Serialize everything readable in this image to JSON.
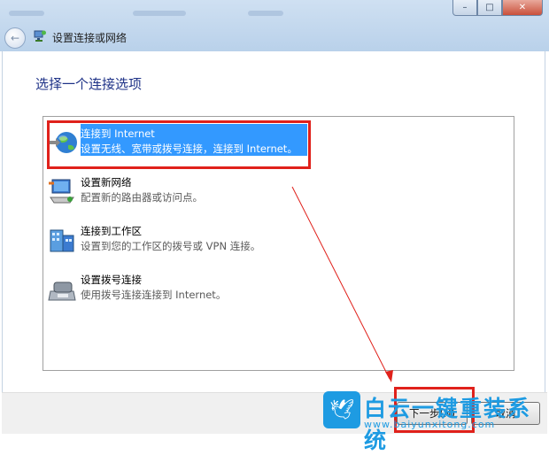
{
  "window": {
    "nav_title": "设置连接或网络",
    "min_label": "–",
    "max_label": "□",
    "close_label": "✕",
    "back_label": "←"
  },
  "main": {
    "heading": "选择一个连接选项",
    "options": [
      {
        "title": "连接到 Internet",
        "desc": "设置无线、宽带或拨号连接，连接到 Internet。",
        "icon": "globe-icon",
        "selected": true
      },
      {
        "title": "设置新网络",
        "desc": "配置新的路由器或访问点。",
        "icon": "network-icon",
        "selected": false
      },
      {
        "title": "连接到工作区",
        "desc": "设置到您的工作区的拨号或 VPN 连接。",
        "icon": "workplace-icon",
        "selected": false
      },
      {
        "title": "设置拨号连接",
        "desc": "使用拨号连接连接到 Internet。",
        "icon": "phone-icon",
        "selected": false
      }
    ]
  },
  "footer": {
    "next_label": "下一步(N)",
    "cancel_label": "取消"
  },
  "watermark": {
    "title": "白云一键重装系统",
    "url": "www.baiyunxitong.com"
  },
  "colors": {
    "selection": "#3399ff",
    "annotation": "#e0211b",
    "heading": "#1e3287",
    "watermark": "#1e9be2"
  }
}
